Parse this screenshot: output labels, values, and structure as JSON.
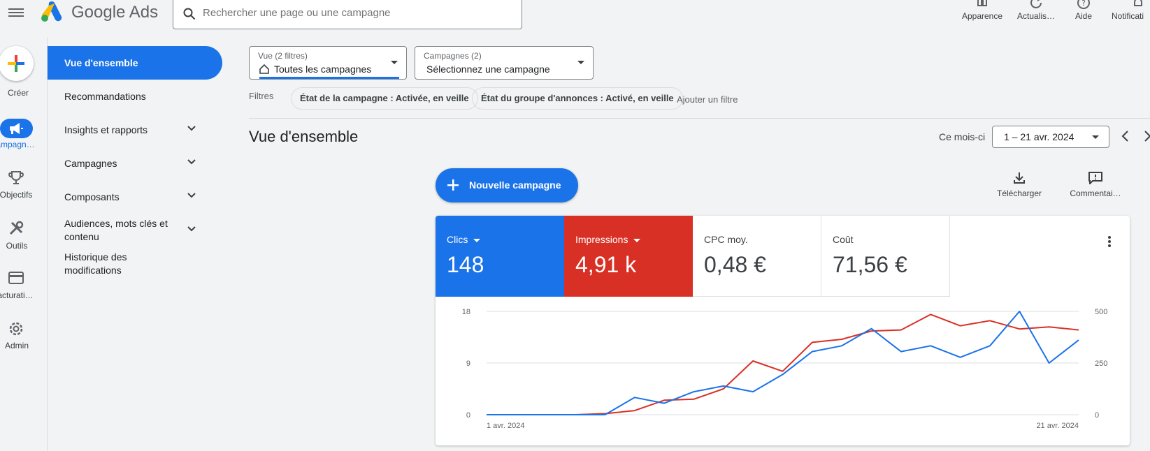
{
  "app": {
    "brand": "Google Ads"
  },
  "search": {
    "placeholder": "Rechercher une page ou une campagne"
  },
  "top_actions": [
    {
      "label": "Apparence",
      "icon": "appearance-icon"
    },
    {
      "label": "Actualis…",
      "icon": "refresh-icon"
    },
    {
      "label": "Aide",
      "icon": "help-icon"
    },
    {
      "label": "Notificati",
      "icon": "bell-icon"
    }
  ],
  "rail": {
    "create": "Créer",
    "items": [
      {
        "label": "ampagn…",
        "icon": "megaphone-icon"
      },
      {
        "label": "Objectifs",
        "icon": "trophy-icon"
      },
      {
        "label": "Outils",
        "icon": "tools-icon"
      },
      {
        "label": "acturati…",
        "icon": "credit-card-icon"
      },
      {
        "label": "Admin",
        "icon": "gear-icon"
      }
    ]
  },
  "sidenav": {
    "items": [
      {
        "label": "Vue d'ensemble",
        "active": true
      },
      {
        "label": "Recommandations"
      },
      {
        "label": "Insights et rapports",
        "expandable": true
      },
      {
        "label": "Campagnes",
        "expandable": true
      },
      {
        "label": "Composants",
        "expandable": true
      },
      {
        "label": "Audiences, mots clés et contenu",
        "expandable": true
      },
      {
        "label": "Historique des modifications"
      }
    ]
  },
  "view_select": {
    "caption": "Vue (2 filtres)",
    "value": "Toutes les campagnes"
  },
  "campaign_select": {
    "caption": "Campagnes (2)",
    "value": "Sélectionnez une campagne"
  },
  "filters": {
    "label": "Filtres",
    "chips": [
      "État de la campagne : Activée, en veille",
      "État du groupe d'annonces : Activé, en veille"
    ],
    "add": "Ajouter un filtre"
  },
  "overview": {
    "title": "Vue d'ensemble",
    "period_label": "Ce mois-ci",
    "date_range": "1 – 21 avr. 2024",
    "new_campaign": "Nouvelle campagne",
    "download": "Télécharger",
    "comments": "Commentai…"
  },
  "metrics": [
    {
      "label": "Clics",
      "value": "148",
      "color": "#1a73e8",
      "dropdown": true
    },
    {
      "label": "Impressions",
      "value": "4,91 k",
      "color": "#d93025",
      "dropdown": true
    },
    {
      "label": "CPC moy.",
      "value": "0,48 €"
    },
    {
      "label": "Coût",
      "value": "71,56 €"
    }
  ],
  "chart_data": {
    "type": "line",
    "x": [
      "1 avr. 2024",
      "2",
      "3",
      "4",
      "5",
      "6",
      "7",
      "8",
      "9",
      "10",
      "11",
      "12",
      "13",
      "14",
      "15",
      "16",
      "17",
      "18",
      "19",
      "20",
      "21 avr. 2024"
    ],
    "x_tick_labels": [
      "1 avr. 2024",
      "21 avr. 2024"
    ],
    "left_axis": {
      "ticks": [
        "0",
        "9",
        "18"
      ],
      "ylim": [
        0,
        18
      ]
    },
    "right_axis": {
      "ticks": [
        "0",
        "250",
        "500"
      ],
      "ylim": [
        0,
        500
      ]
    },
    "grid": true,
    "series": [
      {
        "name": "Clics",
        "axis": "left",
        "color": "#1a73e8",
        "values": [
          0,
          0,
          0,
          0,
          0,
          3,
          2,
          4,
          5,
          4,
          7,
          11,
          12,
          15,
          11,
          12,
          10,
          12,
          18,
          9,
          13
        ]
      },
      {
        "name": "Impressions",
        "axis": "right",
        "color": "#d93025",
        "values": [
          0,
          0,
          0,
          0,
          5,
          20,
          70,
          75,
          125,
          260,
          210,
          350,
          365,
          405,
          410,
          485,
          430,
          455,
          415,
          425,
          410
        ]
      }
    ]
  }
}
